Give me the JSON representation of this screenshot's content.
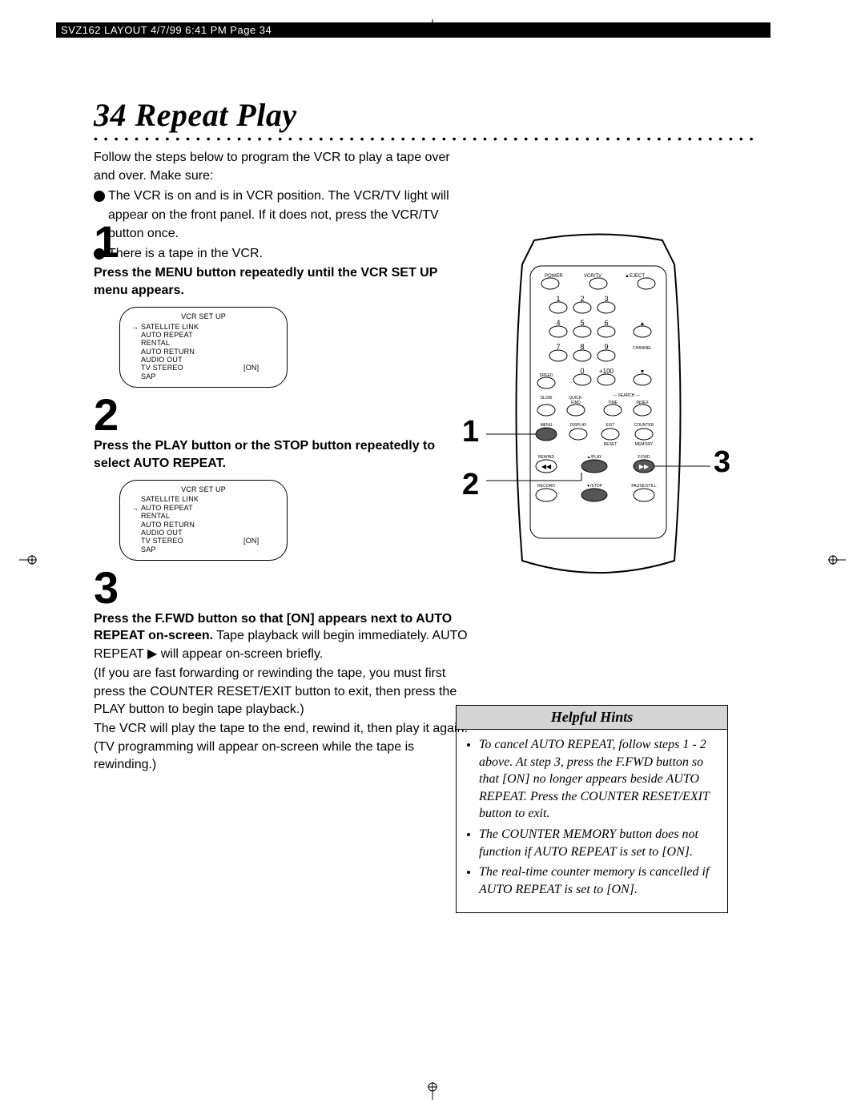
{
  "header": "SVZ162 LAYOUT  4/7/99 6:41 PM  Page 34",
  "page_number": "34",
  "title": "34 Repeat Play",
  "intro1": "Follow the steps below to program the VCR to play a tape over and over. Make sure:",
  "intro_bullet1": "The VCR is on and is in VCR position. The VCR/TV light will appear on the front panel. If it does not, press the VCR/TV button once.",
  "intro_bullet2": "There is a tape in the VCR.",
  "step1_num": "1",
  "step1_head": "Press the MENU button repeatedly until the VCR SET UP menu appears.",
  "menu1": {
    "title": "VCR SET UP",
    "rows": [
      {
        "arrow": "→",
        "label": "SATELLITE LINK",
        "val": ""
      },
      {
        "arrow": "",
        "label": "AUTO REPEAT",
        "val": ""
      },
      {
        "arrow": "",
        "label": "RENTAL",
        "val": ""
      },
      {
        "arrow": "",
        "label": "AUTO RETURN",
        "val": ""
      },
      {
        "arrow": "",
        "label": "AUDIO OUT",
        "val": ""
      },
      {
        "arrow": "",
        "label": "TV STEREO",
        "val": "[ON]"
      },
      {
        "arrow": "",
        "label": "SAP",
        "val": ""
      }
    ]
  },
  "step2_num": "2",
  "step2_head": "Press the PLAY button or the STOP button repeatedly to select AUTO REPEAT.",
  "menu2": {
    "title": "VCR SET UP",
    "rows": [
      {
        "arrow": "",
        "label": "SATELLITE LINK",
        "val": ""
      },
      {
        "arrow": "→",
        "label": "AUTO REPEAT",
        "val": ""
      },
      {
        "arrow": "",
        "label": "RENTAL",
        "val": ""
      },
      {
        "arrow": "",
        "label": "AUTO RETURN",
        "val": ""
      },
      {
        "arrow": "",
        "label": "AUDIO OUT",
        "val": ""
      },
      {
        "arrow": "",
        "label": "TV STEREO",
        "val": "[ON]"
      },
      {
        "arrow": "",
        "label": "SAP",
        "val": ""
      }
    ]
  },
  "step3_num": "3",
  "step3_head": "Press the F.FWD button so that [ON] appears next to AUTO REPEAT on-screen.",
  "step3_body1": " Tape playback will begin immediately.  AUTO REPEAT ▶ will appear on-screen briefly.",
  "step3_body2": "(If you are fast forwarding or rewinding the tape, you must first press the COUNTER RESET/EXIT button to exit, then press the PLAY button to begin tape playback.)",
  "step3_body3": "The VCR will play the tape to the end, rewind it, then play it again. (TV programming will appear on-screen while the tape is rewinding.)",
  "remote": {
    "topLabels": {
      "power": "POWER",
      "vcrtv": "VCR/TV",
      "eject": "▲EJECT"
    },
    "num1": "1",
    "num2": "2",
    "num3": "3",
    "num4": "4",
    "num5": "5",
    "num6": "6",
    "num7": "7",
    "num8": "8",
    "num9": "9",
    "num0": "0",
    "plus100": "+100",
    "channel": "CHANNEL",
    "up": "▲",
    "down": "▼",
    "speed": "SPEED",
    "slow": "SLOW",
    "quick": "QUICK-\nFIND",
    "search": "SEARCH",
    "time": "TIME",
    "index": "INDEX",
    "menu": "MENU",
    "display": "DISPLAY",
    "exit": "EXIT",
    "counter": "COUNTER",
    "reset": "RESET",
    "memory": "MEMORY",
    "rewind": "REWIND",
    "play": "▲/PLAY",
    "ffwd": "F.FWD",
    "record": "RECORD",
    "stop": "▼/STOP",
    "pause": "PAUSE/STILL",
    "rewSym": "◀◀",
    "ffwdSym": "▶▶"
  },
  "callouts": {
    "c1": "1",
    "c2": "2",
    "c3": "3"
  },
  "hints_title": "Helpful Hints",
  "hint1": "To cancel AUTO REPEAT, follow steps 1 - 2 above.  At step 3, press the F.FWD button so that [ON] no longer appears beside AUTO REPEAT.  Press the COUNTER RESET/EXIT button to exit.",
  "hint2": "The COUNTER MEMORY button does not function if AUTO REPEAT is set to [ON].",
  "hint3": "The real-time counter memory is cancelled if AUTO REPEAT is set to [ON]."
}
